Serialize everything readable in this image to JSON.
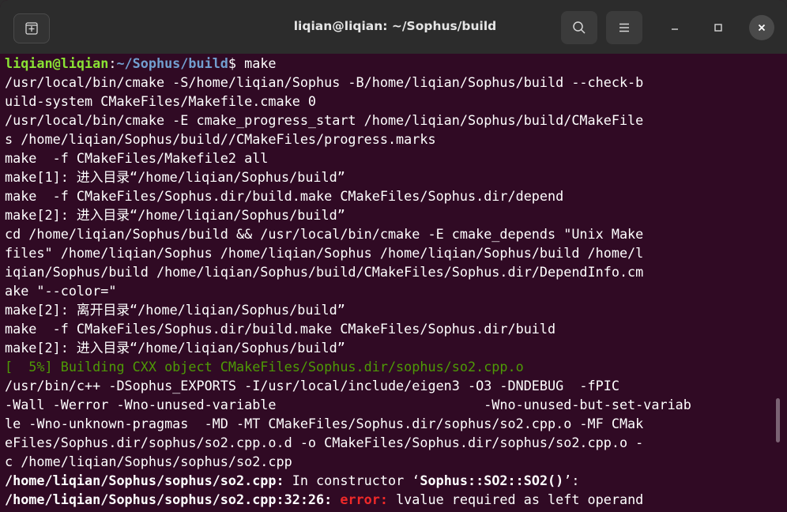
{
  "window": {
    "title": "liqian@liqian: ~/Sophus/build",
    "colors": {
      "background": "#300a24",
      "titlebar": "#2c2c2c",
      "prompt_user": "#8ae234",
      "prompt_path": "#729fcf",
      "error": "#ef2929",
      "build_msg": "#4e9a06"
    }
  },
  "titlebar": {
    "new_tab_icon": "new-tab-icon",
    "search_icon": "search-icon",
    "menu_icon": "hamburger-menu-icon",
    "minimize_icon": "minimize-icon",
    "maximize_icon": "maximize-icon",
    "close_icon": "close-icon"
  },
  "terminal": {
    "prompt": {
      "user": "liqian@liqian",
      "colon": ":",
      "path": "~/Sophus/build",
      "symbol": "$ ",
      "command": "make"
    },
    "lines": [
      "/usr/local/bin/cmake -S/home/liqian/Sophus -B/home/liqian/Sophus/build --check-b",
      "uild-system CMakeFiles/Makefile.cmake 0",
      "/usr/local/bin/cmake -E cmake_progress_start /home/liqian/Sophus/build/CMakeFile",
      "s /home/liqian/Sophus/build//CMakeFiles/progress.marks",
      "make  -f CMakeFiles/Makefile2 all",
      "make[1]: 进入目录“/home/liqian/Sophus/build”",
      "make  -f CMakeFiles/Sophus.dir/build.make CMakeFiles/Sophus.dir/depend",
      "make[2]: 进入目录“/home/liqian/Sophus/build”",
      "cd /home/liqian/Sophus/build && /usr/local/bin/cmake -E cmake_depends \"Unix Make",
      "files\" /home/liqian/Sophus /home/liqian/Sophus /home/liqian/Sophus/build /home/l",
      "iqian/Sophus/build /home/liqian/Sophus/build/CMakeFiles/Sophus.dir/DependInfo.cm",
      "ake \"--color=\"",
      "make[2]: 离开目录“/home/liqian/Sophus/build”",
      "make  -f CMakeFiles/Sophus.dir/build.make CMakeFiles/Sophus.dir/build",
      "make[2]: 进入目录“/home/liqian/Sophus/build”"
    ],
    "progress_line": "[  5%] Building CXX object CMakeFiles/Sophus.dir/sophus/so2.cpp.o",
    "compile_lines": [
      "/usr/bin/c++ -DSophus_EXPORTS -I/usr/local/include/eigen3 -O3 -DNDEBUG  -fPIC",
      "-Wall -Werror -Wno-unused-variable                          -Wno-unused-but-set-variab",
      "le -Wno-unknown-pragmas  -MD -MT CMakeFiles/Sophus.dir/sophus/so2.cpp.o -MF CMak",
      "eFiles/Sophus.dir/sophus/so2.cpp.o.d -o CMakeFiles/Sophus.dir/sophus/so2.cpp.o -",
      "c /home/liqian/Sophus/sophus/so2.cpp"
    ],
    "constructor_line": {
      "location": "/home/liqian/Sophus/sophus/so2.cpp:",
      "text_before": " In constructor ",
      "quote_open": "‘",
      "symbol": "Sophus::SO2::SO2()",
      "quote_close": "’:"
    },
    "error_line": {
      "location": "/home/liqian/Sophus/sophus/so2.cpp:32:26: ",
      "label": "error:",
      "message": " lvalue required as left operand"
    }
  }
}
